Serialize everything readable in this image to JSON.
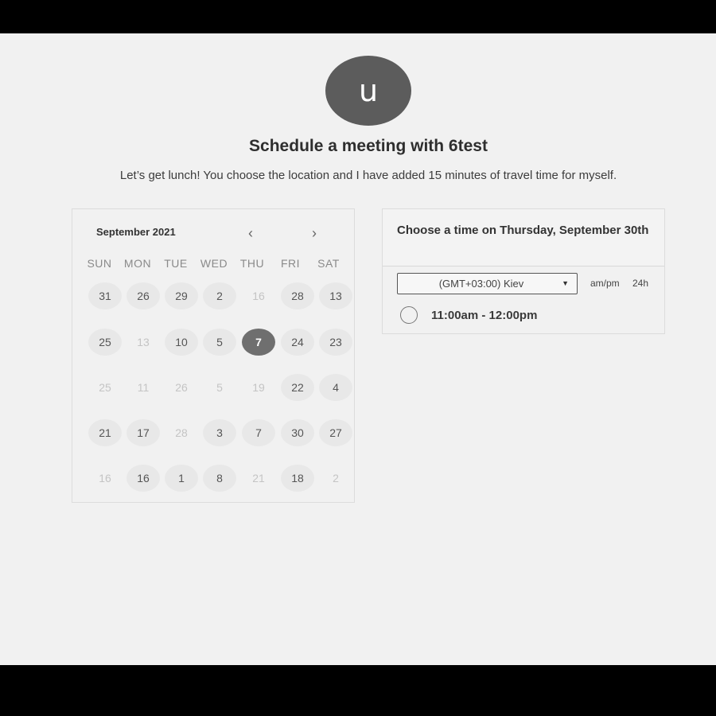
{
  "host": {
    "avatar_initial": "u"
  },
  "heading": {
    "title": "Schedule a meeting with 6test",
    "subtitle": "Let’s get lunch! You choose the location and I have added 15 minutes of travel time for myself."
  },
  "calendar": {
    "month_label": "September 2021",
    "prev_icon": "‹",
    "next_icon": "›",
    "weekdays": [
      "SUN",
      "MON",
      "TUE",
      "WED",
      "THU",
      "FRI",
      "SAT"
    ],
    "weeks": [
      [
        {
          "d": "31",
          "s": "avail"
        },
        {
          "d": "26",
          "s": "avail"
        },
        {
          "d": "29",
          "s": "avail"
        },
        {
          "d": "2",
          "s": "avail"
        },
        {
          "d": "16",
          "s": "disabled"
        },
        {
          "d": "28",
          "s": "avail"
        },
        {
          "d": "13",
          "s": "avail"
        }
      ],
      [
        {
          "d": "25",
          "s": "avail"
        },
        {
          "d": "13",
          "s": "disabled"
        },
        {
          "d": "10",
          "s": "avail"
        },
        {
          "d": "5",
          "s": "avail"
        },
        {
          "d": "7",
          "s": "selected"
        },
        {
          "d": "24",
          "s": "avail"
        },
        {
          "d": "23",
          "s": "avail"
        }
      ],
      [
        {
          "d": "25",
          "s": "disabled"
        },
        {
          "d": "11",
          "s": "disabled"
        },
        {
          "d": "26",
          "s": "disabled"
        },
        {
          "d": "5",
          "s": "disabled"
        },
        {
          "d": "19",
          "s": "disabled"
        },
        {
          "d": "22",
          "s": "avail"
        },
        {
          "d": "4",
          "s": "avail"
        }
      ],
      [
        {
          "d": "21",
          "s": "avail"
        },
        {
          "d": "17",
          "s": "avail"
        },
        {
          "d": "28",
          "s": "disabled"
        },
        {
          "d": "3",
          "s": "avail"
        },
        {
          "d": "7",
          "s": "avail"
        },
        {
          "d": "30",
          "s": "avail"
        },
        {
          "d": "27",
          "s": "avail"
        }
      ],
      [
        {
          "d": "16",
          "s": "disabled"
        },
        {
          "d": "16",
          "s": "avail"
        },
        {
          "d": "1",
          "s": "avail"
        },
        {
          "d": "8",
          "s": "avail"
        },
        {
          "d": "21",
          "s": "disabled"
        },
        {
          "d": "18",
          "s": "avail"
        },
        {
          "d": "2",
          "s": "disabled"
        }
      ]
    ]
  },
  "times": {
    "title": "Choose a time on Thursday, September 30th",
    "timezone": "(GMT+03:00) Kiev",
    "caret_icon": "▼",
    "format_ampm": "am/pm",
    "format_24h": "24h",
    "slots": [
      {
        "label": "11:00am - 12:00pm"
      }
    ]
  }
}
